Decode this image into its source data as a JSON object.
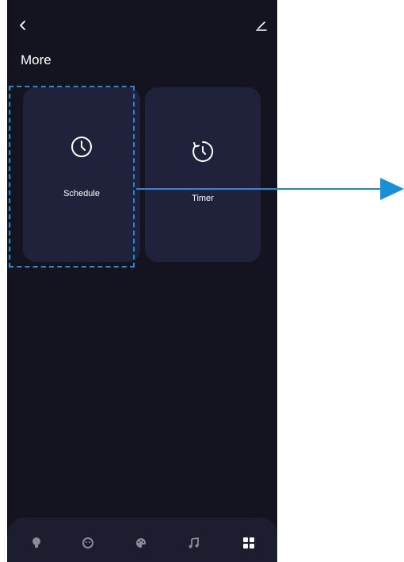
{
  "header": {
    "title": "More"
  },
  "cards": [
    {
      "label": "Schedule",
      "icon": "clock-icon"
    },
    {
      "label": "Timer",
      "icon": "timer-icon"
    }
  ],
  "nav": {
    "items": [
      {
        "icon": "bulb-icon",
        "active": false
      },
      {
        "icon": "mode-icon",
        "active": false
      },
      {
        "icon": "palette-icon",
        "active": false
      },
      {
        "icon": "music-icon",
        "active": false
      },
      {
        "icon": "grid-icon",
        "active": true
      }
    ]
  },
  "colors": {
    "background": "#141420",
    "card": "#20213a",
    "accent": "#1a8fd8",
    "text": "#ffffff",
    "nav_inactive": "#8a8b99"
  }
}
